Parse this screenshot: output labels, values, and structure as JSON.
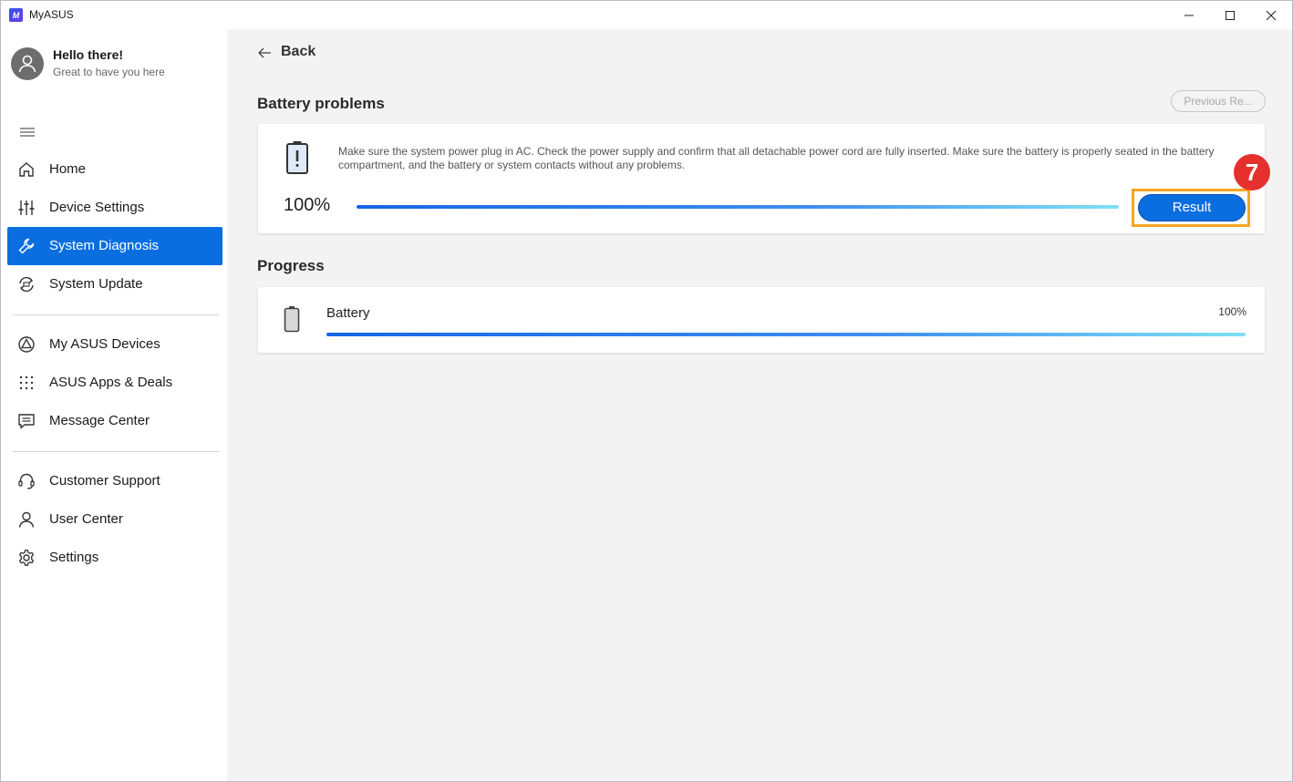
{
  "window": {
    "app_title": "MyASUS",
    "logo_text": "M"
  },
  "profile": {
    "greeting": "Hello there!",
    "subtitle": "Great to have you here"
  },
  "sidebar": {
    "items": [
      {
        "label": "Home",
        "icon": "home-icon"
      },
      {
        "label": "Device Settings",
        "icon": "sliders-icon"
      },
      {
        "label": "System Diagnosis",
        "icon": "wrench-icon",
        "active": true
      },
      {
        "label": "System Update",
        "icon": "update-icon"
      },
      {
        "label": "My ASUS Devices",
        "icon": "devices-icon"
      },
      {
        "label": "ASUS Apps & Deals",
        "icon": "apps-grid-icon"
      },
      {
        "label": "Message Center",
        "icon": "message-icon"
      },
      {
        "label": "Customer Support",
        "icon": "headset-icon"
      },
      {
        "label": "User Center",
        "icon": "user-icon"
      },
      {
        "label": "Settings",
        "icon": "gear-icon"
      }
    ]
  },
  "main": {
    "back_label": "Back",
    "problem_title": "Battery problems",
    "previous_button": "Previous Re...",
    "description": "Make sure the system power plug in AC. Check the power supply and confirm that all detachable power cord are fully inserted.  Make sure the battery is properly seated in the battery compartment, and the battery or system contacts without any problems.",
    "percent": "100%",
    "progress_value": 1.0,
    "result_button": "Result",
    "step_number": "7",
    "progress_title": "Progress",
    "progress_item": {
      "label": "Battery",
      "percent": "100%",
      "value": 1.0
    }
  },
  "colors": {
    "accent": "#0a6ee0",
    "highlight": "#f5a623",
    "badge": "#e6302e"
  }
}
